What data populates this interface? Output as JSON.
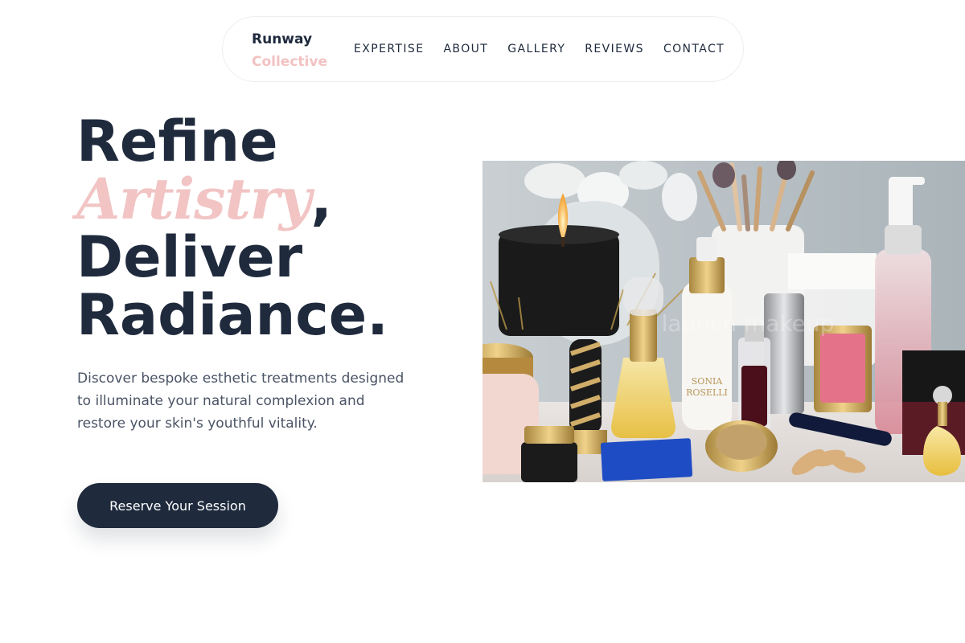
{
  "brand": {
    "line1": "Runway",
    "line2": "Collective"
  },
  "nav": {
    "items": [
      "EXPERTISE",
      "ABOUT",
      "GALLERY",
      "REVIEWS",
      "CONTACT"
    ]
  },
  "hero": {
    "line1": "Refine",
    "accent": "Artistry",
    "comma": ",",
    "line3": "Deliver",
    "line4": "Radiance.",
    "description": "Discover bespoke esthetic treatments designed to illuminate your natural complexion and restore your skin's youthful vitality.",
    "cta_label": "Reserve Your Session"
  },
  "image": {
    "watermark": "launch makeup",
    "label_sonia_1": "SONIA",
    "label_sonia_2": "ROSELLI"
  },
  "colors": {
    "navy": "#1f2a3d",
    "blush": "#f2c2c2",
    "body_text": "#4a5365"
  }
}
